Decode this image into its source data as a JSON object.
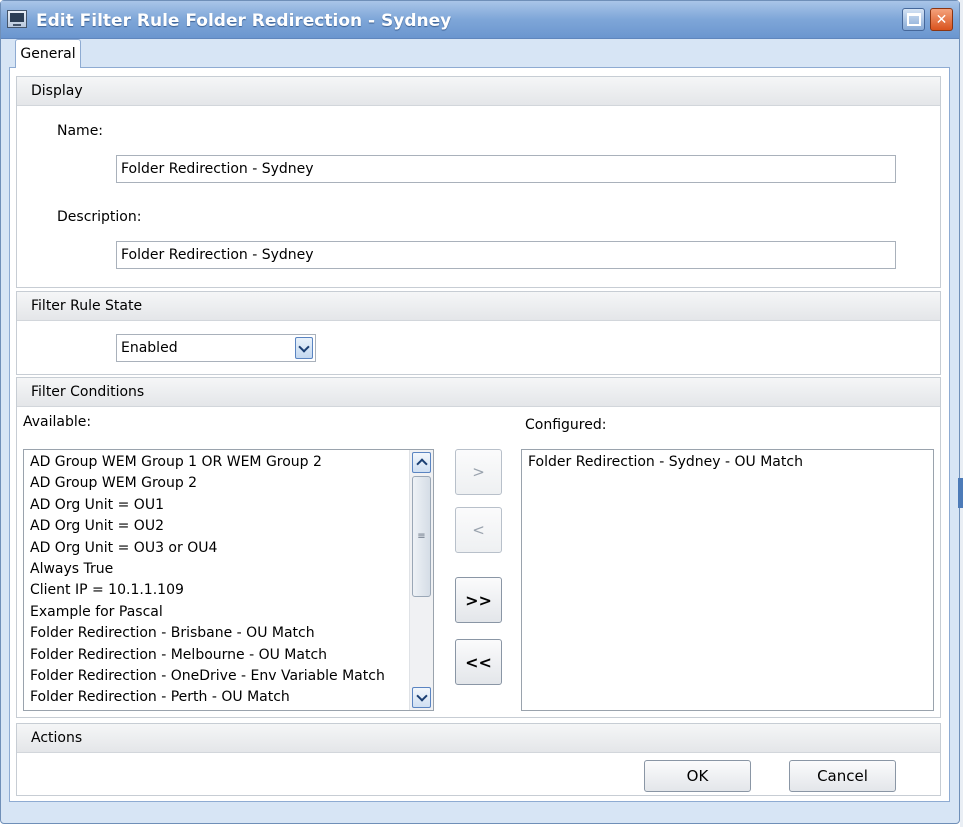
{
  "window": {
    "title": "Edit Filter Rule Folder Redirection - Sydney",
    "restore_icon": "restore-icon",
    "close_icon": "close-icon",
    "close_glyph": "✕"
  },
  "tabs": [
    {
      "label": "General"
    }
  ],
  "display": {
    "header": "Display",
    "name_label": "Name:",
    "name_value": "Folder Redirection - Sydney",
    "description_label": "Description:",
    "description_value": "Folder Redirection - Sydney"
  },
  "state": {
    "header": "Filter Rule State",
    "selected": "Enabled"
  },
  "conditions": {
    "header": "Filter Conditions",
    "available_label": "Available:",
    "configured_label": "Configured:",
    "available": [
      "AD Group WEM Group 1 OR WEM Group 2",
      "AD Group WEM Group 2",
      "AD Org Unit = OU1",
      "AD Org Unit = OU2",
      "AD Org Unit = OU3 or OU4",
      "Always True",
      "Client IP = 10.1.1.109",
      "Example for Pascal",
      "Folder Redirection - Brisbane - OU Match",
      "Folder Redirection - Melbourne - OU Match",
      "Folder Redirection - OneDrive - Env Variable Match",
      "Folder Redirection - Perth - OU Match"
    ],
    "configured": [
      "Folder Redirection - Sydney - OU Match"
    ],
    "buttons": {
      "add": ">",
      "remove": "<",
      "add_all": ">>",
      "remove_all": "<<"
    },
    "thumb_grip": "≡"
  },
  "actions": {
    "header": "Actions",
    "ok": "OK",
    "cancel": "Cancel"
  }
}
